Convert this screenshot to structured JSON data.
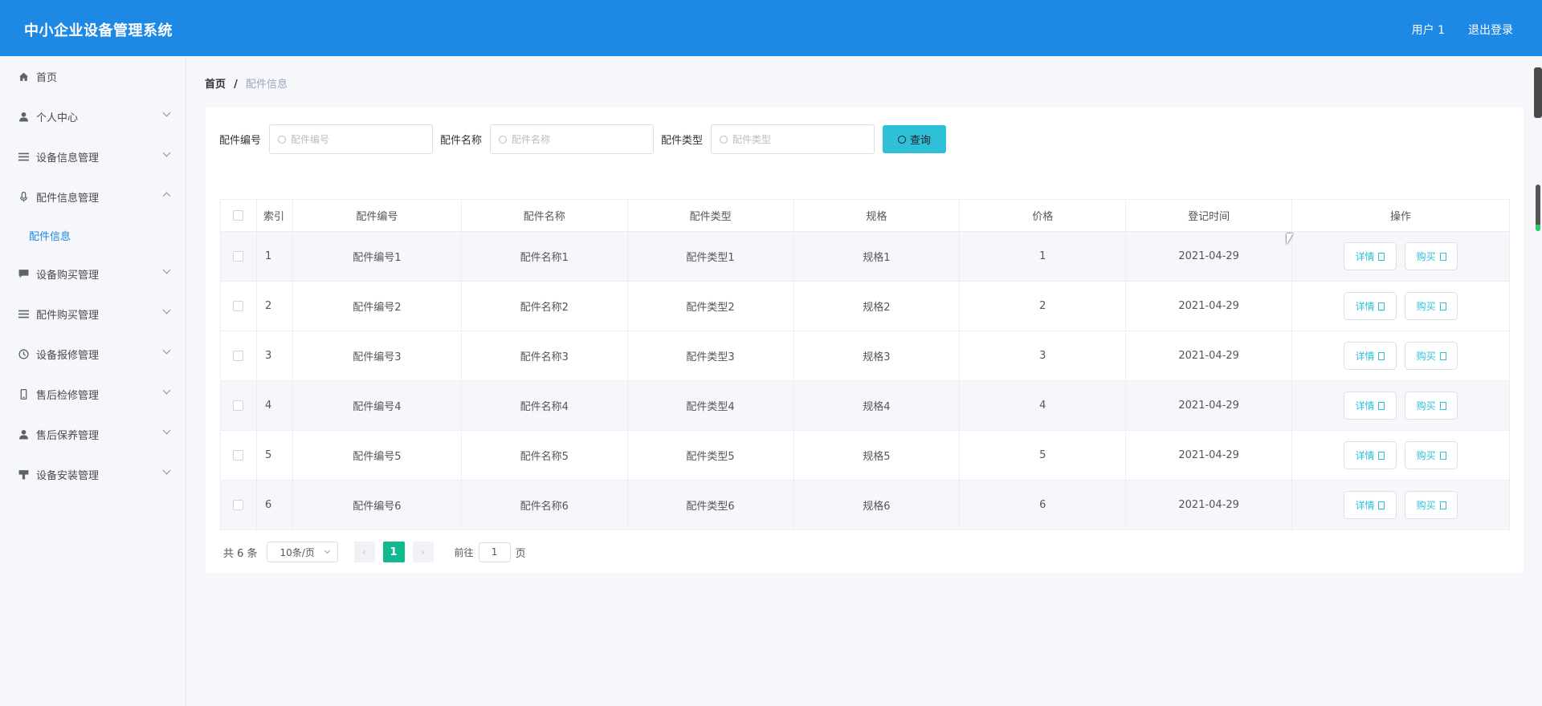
{
  "header": {
    "title": "中小企业设备管理系统",
    "user": "用户 1",
    "logout": "退出登录"
  },
  "sidebar": {
    "items": [
      {
        "label": "首页",
        "icon": "home-icon"
      },
      {
        "label": "个人中心",
        "icon": "user-icon"
      },
      {
        "label": "设备信息管理",
        "icon": "list-icon"
      },
      {
        "label": "配件信息管理",
        "icon": "mic-icon"
      },
      {
        "label": "设备购买管理",
        "icon": "chat-icon"
      },
      {
        "label": "配件购买管理",
        "icon": "list-icon"
      },
      {
        "label": "设备报修管理",
        "icon": "clock-icon"
      },
      {
        "label": "售后检修管理",
        "icon": "phone-icon"
      },
      {
        "label": "售后保养管理",
        "icon": "user-icon"
      },
      {
        "label": "设备安装管理",
        "icon": "install-icon"
      }
    ],
    "submenu_label": "配件信息"
  },
  "breadcrumb": {
    "home": "首页",
    "sep": "/",
    "current": "配件信息"
  },
  "search": {
    "code_label": "配件编号",
    "code_placeholder": "配件编号",
    "name_label": "配件名称",
    "name_placeholder": "配件名称",
    "type_label": "配件类型",
    "type_placeholder": "配件类型",
    "query_label": "查询"
  },
  "table": {
    "columns": [
      "索引",
      "配件编号",
      "配件名称",
      "配件类型",
      "规格",
      "价格",
      "登记时间",
      "操作"
    ],
    "rows": [
      {
        "index": "1",
        "code": "配件编号1",
        "name": "配件名称1",
        "type": "配件类型1",
        "spec": "规格1",
        "price": "1",
        "date": "2021-04-29"
      },
      {
        "index": "2",
        "code": "配件编号2",
        "name": "配件名称2",
        "type": "配件类型2",
        "spec": "规格2",
        "price": "2",
        "date": "2021-04-29"
      },
      {
        "index": "3",
        "code": "配件编号3",
        "name": "配件名称3",
        "type": "配件类型3",
        "spec": "规格3",
        "price": "3",
        "date": "2021-04-29"
      },
      {
        "index": "4",
        "code": "配件编号4",
        "name": "配件名称4",
        "type": "配件类型4",
        "spec": "规格4",
        "price": "4",
        "date": "2021-04-29"
      },
      {
        "index": "5",
        "code": "配件编号5",
        "name": "配件名称5",
        "type": "配件类型5",
        "spec": "规格5",
        "price": "5",
        "date": "2021-04-29"
      },
      {
        "index": "6",
        "code": "配件编号6",
        "name": "配件名称6",
        "type": "配件类型6",
        "spec": "规格6",
        "price": "6",
        "date": "2021-04-29"
      }
    ],
    "detail_label": "详情",
    "buy_label": "购买"
  },
  "pagination": {
    "total": "共 6 条",
    "page_size": "10条/页",
    "current_page": "1",
    "goto_label": "前往",
    "goto_value": "1",
    "page_unit": "页"
  },
  "colors": {
    "header": "#1e88e5",
    "accent": "#2ec0d6",
    "page_active": "#10b98f"
  }
}
